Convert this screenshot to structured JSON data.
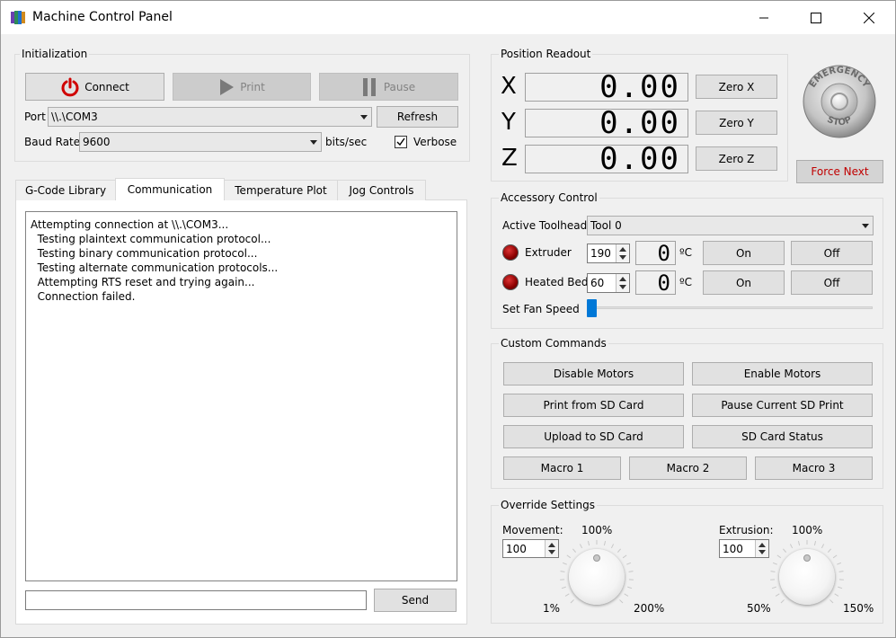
{
  "window": {
    "title": "Machine Control Panel",
    "minimize_icon": "minimize-icon",
    "maximize_icon": "maximize-icon",
    "close_icon": "close-icon"
  },
  "initialization": {
    "group_title": "Initialization",
    "connect_label": "Connect",
    "print_label": "Print",
    "pause_label": "Pause",
    "port_label": "Port",
    "port_value": "\\\\.\\COM3",
    "refresh_label": "Refresh",
    "baud_label": "Baud Rate",
    "baud_value": "9600",
    "baud_unit": "bits/sec",
    "verbose_label": "Verbose",
    "verbose_checked": true
  },
  "tabs": [
    {
      "label": "G-Code Library",
      "active": false
    },
    {
      "label": "Communication",
      "active": true
    },
    {
      "label": "Temperature Plot",
      "active": false
    },
    {
      "label": "Jog Controls",
      "active": false
    }
  ],
  "console": {
    "lines": [
      "Attempting connection at \\\\.\\COM3...",
      "  Testing plaintext communication protocol...",
      "  Testing binary communication protocol...",
      "  Testing alternate communication protocols...",
      "  Attempting RTS reset and trying again...",
      "  Connection failed."
    ],
    "command_value": "",
    "send_label": "Send"
  },
  "position": {
    "group_title": "Position Readout",
    "axes": [
      {
        "axis": "X",
        "value": "0.00",
        "zero_label": "Zero X"
      },
      {
        "axis": "Y",
        "value": "0.00",
        "zero_label": "Zero Y"
      },
      {
        "axis": "Z",
        "value": "0.00",
        "zero_label": "Zero Z"
      }
    ]
  },
  "emergency": {
    "text_top": "EMERGENCY",
    "text_bottom": "STOP",
    "force_next_label": "Force Next"
  },
  "accessory": {
    "group_title": "Accessory Control",
    "toolhead_label": "Active Toolhead",
    "toolhead_value": "Tool 0",
    "extruder_label": "Extruder",
    "extruder_set": "190",
    "extruder_temp": "0",
    "bed_label": "Heated Bed",
    "bed_set": "60",
    "bed_temp": "0",
    "unit": "ºC",
    "on_label": "On",
    "off_label": "Off",
    "fan_label": "Set Fan Speed",
    "fan_value": 0
  },
  "custom": {
    "group_title": "Custom Commands",
    "disable_motors": "Disable Motors",
    "enable_motors": "Enable Motors",
    "print_sd": "Print from SD Card",
    "pause_sd": "Pause Current SD Print",
    "upload_sd": "Upload to SD Card",
    "sd_status": "SD Card Status",
    "macro1": "Macro 1",
    "macro2": "Macro 2",
    "macro3": "Macro 3"
  },
  "override": {
    "group_title": "Override Settings",
    "movement_label": "Movement:",
    "movement_value": "100",
    "movement_top": "100%",
    "movement_min": "1%",
    "movement_max": "200%",
    "extrusion_label": "Extrusion:",
    "extrusion_value": "100",
    "extrusion_top": "100%",
    "extrusion_min": "50%",
    "extrusion_max": "150%"
  },
  "colors": {
    "power_icon": "#d00000",
    "force_next_text": "#c00000",
    "fan_slider": "#0078d7",
    "led_off": "#8b0000"
  }
}
